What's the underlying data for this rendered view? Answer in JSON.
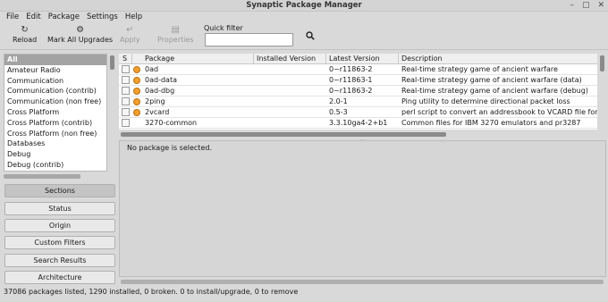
{
  "window": {
    "title": "Synaptic Package Manager",
    "controls": [
      "–",
      "▢",
      "✕"
    ]
  },
  "menu": [
    "File",
    "Edit",
    "Package",
    "Settings",
    "Help"
  ],
  "toolbar": {
    "reload": {
      "label": "Reload",
      "icon": "reload-icon"
    },
    "mark_all": {
      "label": "Mark All Upgrades",
      "icon": "gear-icon"
    },
    "apply": {
      "label": "Apply",
      "icon": "apply-arrow-icon",
      "enabled": false
    },
    "properties": {
      "label": "Properties",
      "icon": "properties-icon",
      "enabled": false
    },
    "quick_filter_label": "Quick filter",
    "quick_filter_value": ""
  },
  "categories": [
    "All",
    "Amateur Radio",
    "Communication",
    "Communication (contrib)",
    "Communication (non free)",
    "Cross Platform",
    "Cross Platform (contrib)",
    "Cross Platform (non free)",
    "Databases",
    "Debug",
    "Debug (contrib)"
  ],
  "selected_category": "All",
  "side_buttons": [
    "Sections",
    "Status",
    "Origin",
    "Custom Filters",
    "Search Results",
    "Architecture"
  ],
  "active_side_button": "Sections",
  "columns": [
    "S",
    "Package",
    "Installed Version",
    "Latest Version",
    "Description"
  ],
  "packages": [
    {
      "name": "0ad",
      "installed": "",
      "latest": "0~r11863-2",
      "description": "Real-time strategy game of ancient warfare",
      "supported": true
    },
    {
      "name": "0ad-data",
      "installed": "",
      "latest": "0~r11863-1",
      "description": "Real-time strategy game of ancient warfare (data)",
      "supported": true
    },
    {
      "name": "0ad-dbg",
      "installed": "",
      "latest": "0~r11863-2",
      "description": "Real-time strategy game of ancient warfare (debug)",
      "supported": true
    },
    {
      "name": "2ping",
      "installed": "",
      "latest": "2.0-1",
      "description": "Ping utility to determine directional packet loss",
      "supported": true
    },
    {
      "name": "2vcard",
      "installed": "",
      "latest": "0.5-3",
      "description": "perl script to convert an addressbook to VCARD file format",
      "supported": true
    },
    {
      "name": "3270-common",
      "installed": "",
      "latest": "3.3.10ga4-2+b1",
      "description": "Common files for IBM 3270 emulators and pr3287",
      "supported": false
    }
  ],
  "details_message": "No package is selected.",
  "status": "37086 packages listed, 1290 installed, 0 broken. 0 to install/upgrade, 0 to remove",
  "colors": {
    "support_dot": "#f0a030",
    "selected_category_bg": "#a3a3a3"
  }
}
